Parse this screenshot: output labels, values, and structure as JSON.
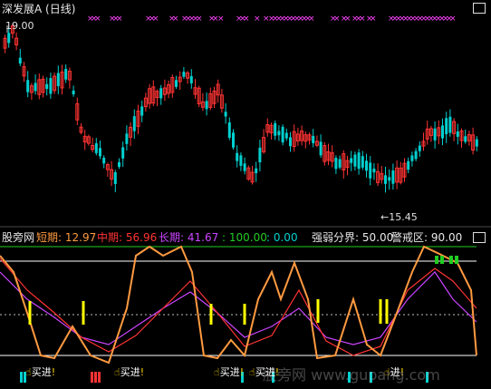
{
  "main": {
    "title": "深发展A (日线)",
    "high_label": "19.00",
    "low_label": "←15.45",
    "high_arrow": "←",
    "colors": {
      "up": "#ff3333",
      "down": "#00d0d0",
      "marker": "#ff44ff"
    }
  },
  "indicator": {
    "name": "股旁网",
    "short_label": "短期: 12.97",
    "mid_label": "中期: 56.96",
    "long_label": "长期: 41.67",
    "top_value": ": 100.00",
    "bottom_value": ": 0.00",
    "strength_label": "强弱分界: 50.00",
    "warning_label": "警戒区: 90.00",
    "colors": {
      "short": "#ff9a40",
      "mid": "#ff3333",
      "long": "#cc44ff",
      "green": "#22cc22",
      "yellow": "#ffff00",
      "white": "#ffffff"
    }
  },
  "signals": [
    {
      "text": "买进"
    },
    {
      "text": "买进"
    },
    {
      "text": "买进"
    },
    {
      "text": "买进"
    },
    {
      "text": "进"
    }
  ],
  "watermark": "股旁网 www.gupang.com"
}
